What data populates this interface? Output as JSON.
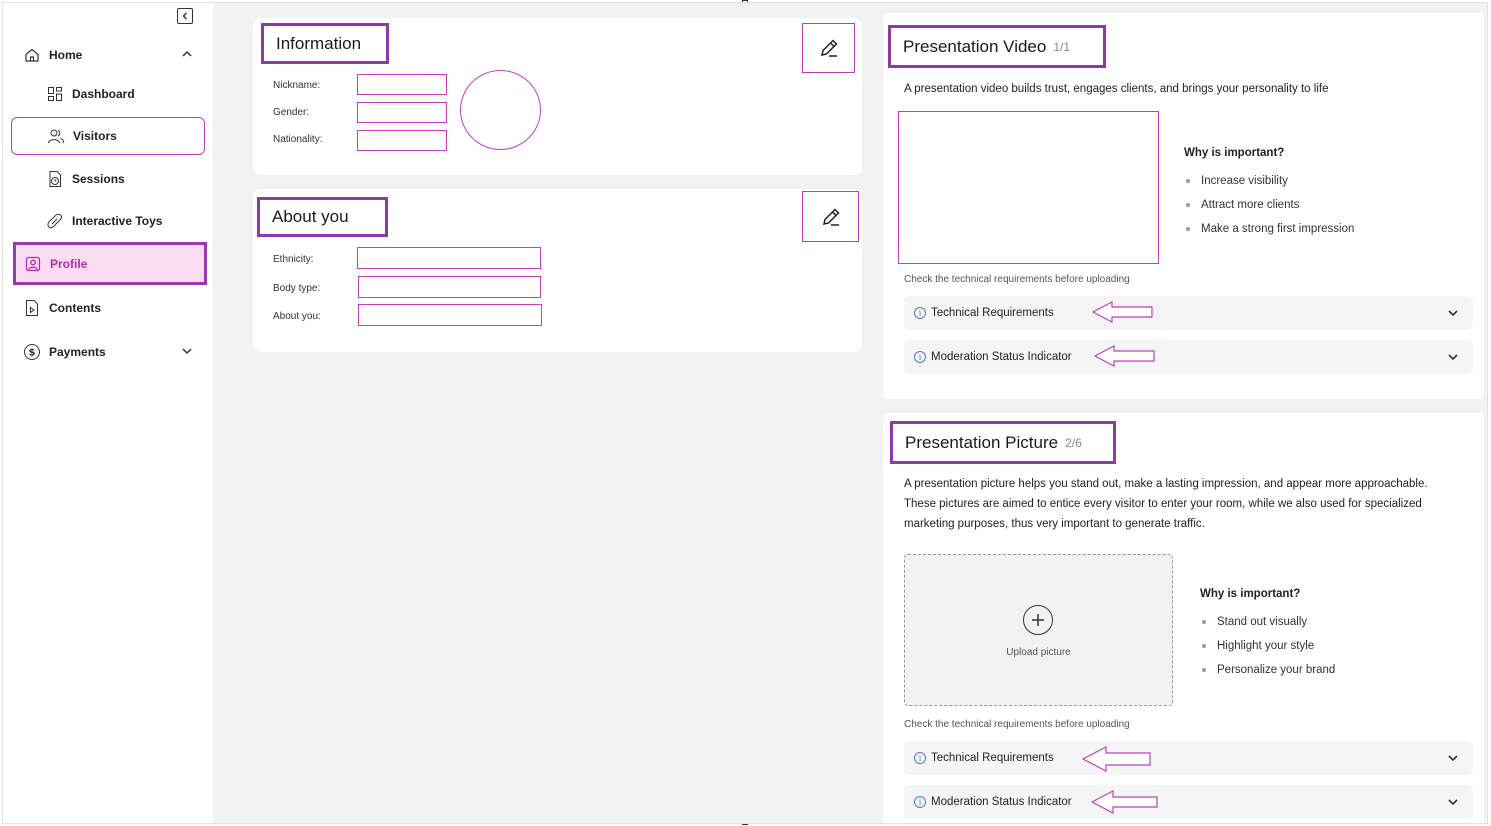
{
  "sidebar": {
    "items": [
      {
        "label": "Home",
        "icon": "home-icon"
      },
      {
        "label": "Dashboard",
        "icon": "dashboard-icon"
      },
      {
        "label": "Visitors",
        "icon": "visitors-icon"
      },
      {
        "label": "Sessions",
        "icon": "sessions-icon"
      },
      {
        "label": "Interactive Toys",
        "icon": "toys-icon"
      },
      {
        "label": "Profile",
        "icon": "profile-icon"
      },
      {
        "label": "Contents",
        "icon": "contents-icon"
      },
      {
        "label": "Payments",
        "icon": "payments-icon"
      }
    ]
  },
  "information": {
    "title": "Information",
    "fields": [
      {
        "label": "Nickname:"
      },
      {
        "label": "Gender:"
      },
      {
        "label": "Nationality:"
      }
    ]
  },
  "about": {
    "title": "About you",
    "fields": [
      {
        "label": "Ethnicity:"
      },
      {
        "label": "Body type:"
      },
      {
        "label": "About you:"
      }
    ]
  },
  "video": {
    "title": "Presentation Video",
    "count": "1/1",
    "description": "A presentation video builds trust, engages clients, and brings your personality to life",
    "why_title": "Why is important?",
    "bullets": [
      "Increase visibility",
      "Attract more clients",
      "Make a strong first impression"
    ],
    "hint": "Check the technical requirements before uploading",
    "accordion": [
      "Technical Requirements",
      "Moderation Status Indicator"
    ]
  },
  "picture": {
    "title": "Presentation Picture",
    "count": "2/6",
    "description_lines": [
      "A presentation picture helps you stand out, make a lasting impression, and appear more approachable.",
      "These pictures are aimed to entice every visitor to enter your room, while we also used for specialized",
      "marketing purposes, thus very important to generate traffic."
    ],
    "upload_label": "Upload picture",
    "why_title": "Why is important?",
    "bullets": [
      "Stand out visually",
      "Highlight your style",
      "Personalize your brand"
    ],
    "hint": "Check the technical requirements before uploading",
    "accordion": [
      "Technical Requirements",
      "Moderation Status Indicator"
    ]
  },
  "colors": {
    "accent": "#8e3aa5",
    "active_bg": "#fbdcf3",
    "active_text": "#b02fa8",
    "outline_pink": "#c03fbd",
    "main_bg": "#f2f2f2",
    "info_blue": "#4a7bd0"
  }
}
